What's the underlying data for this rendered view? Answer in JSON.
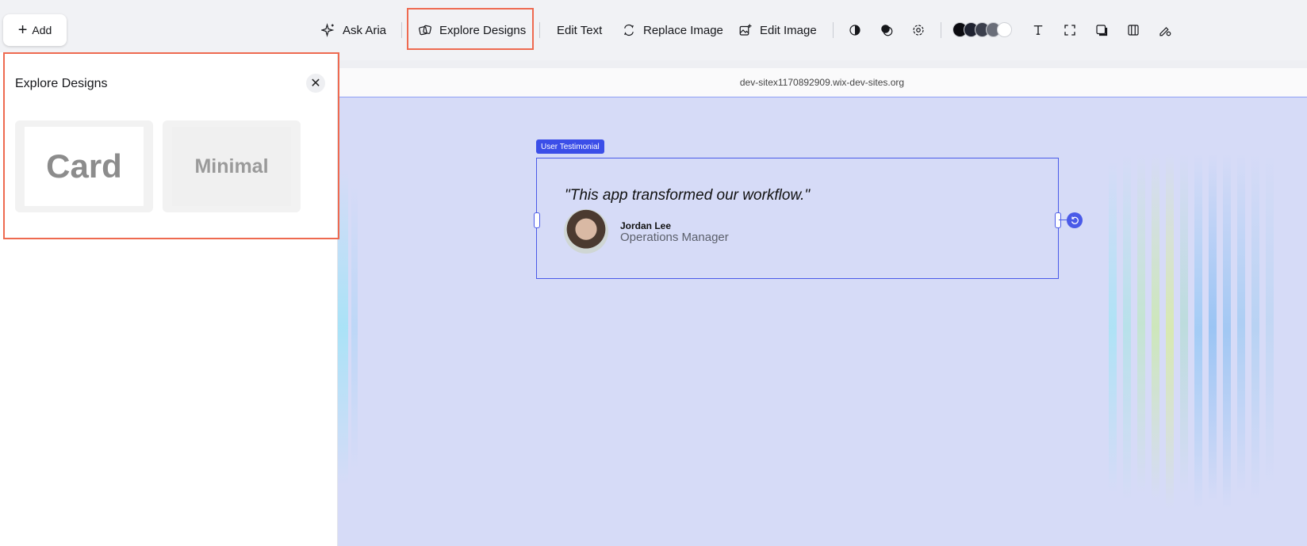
{
  "toolbar": {
    "add_label": "Add",
    "ask_aria": "Ask Aria",
    "explore_designs": "Explore Designs",
    "edit_text": "Edit Text",
    "replace_image": "Replace Image",
    "edit_image": "Edit Image",
    "icons": [
      "contrast-icon",
      "fill-icon",
      "settings-icon",
      "text-style-icon",
      "resize-icon",
      "shadow-icon",
      "layout-icon",
      "design-settings-icon"
    ],
    "swatch_colors": [
      "#0b0b10",
      "#1f2230",
      "#3b3f4c",
      "#6a6e79",
      "#ffffff"
    ]
  },
  "url": "dev-sitex1170892909.wix-dev-sites.org",
  "panel": {
    "title": "Explore Designs",
    "close": "✕",
    "designs": [
      {
        "label": "Card"
      },
      {
        "label": "Minimal"
      }
    ]
  },
  "canvas": {
    "selection_tag": "User Testimonial",
    "testimonial": {
      "quote": "\"This app transformed our workflow.\"",
      "name": "Jordan Lee",
      "role": "Operations Manager"
    }
  },
  "colors": {
    "highlight": "#ee6a50",
    "selection": "#4a5ae8",
    "canvas_bg": "#d6dbf7"
  }
}
